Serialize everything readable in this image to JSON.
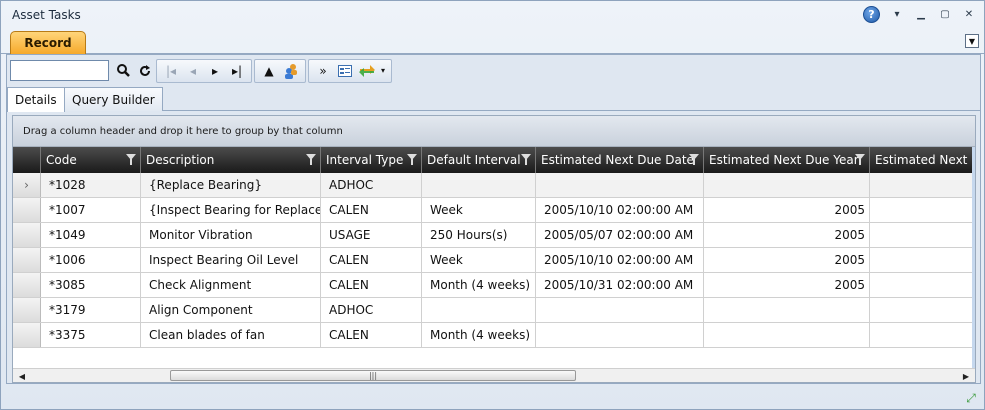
{
  "window": {
    "title": "Asset Tasks"
  },
  "tabs": {
    "record": "Record"
  },
  "subtabs": [
    {
      "label": "Details"
    },
    {
      "label": "Query Builder"
    }
  ],
  "search": {
    "value": "",
    "placeholder": ""
  },
  "grid": {
    "group_hint": "Drag a column header and drop it here to group by that column",
    "columns": [
      "Code",
      "Description",
      "Interval Type",
      "Default Interval",
      "Estimated Next Due Date",
      "Estimated Next Due Year",
      "Estimated Next D"
    ],
    "rows": [
      {
        "code": "*1028",
        "description": "{Replace Bearing}",
        "interval_type": "ADHOC",
        "default_interval": "",
        "due_date": "",
        "due_year": "",
        "next": ""
      },
      {
        "code": "*1007",
        "description": "{Inspect Bearing for Replacem",
        "interval_type": "CALEN",
        "default_interval": "Week",
        "due_date": "2005/10/10 02:00:00 AM",
        "due_year": "2005",
        "next": ""
      },
      {
        "code": "*1049",
        "description": "Monitor Vibration",
        "interval_type": "USAGE",
        "default_interval": "250 Hours(s)",
        "due_date": "2005/05/07 02:00:00 AM",
        "due_year": "2005",
        "next": ""
      },
      {
        "code": "*1006",
        "description": "Inspect Bearing Oil Level",
        "interval_type": "CALEN",
        "default_interval": "Week",
        "due_date": "2005/10/10 02:00:00 AM",
        "due_year": "2005",
        "next": ""
      },
      {
        "code": "*3085",
        "description": "Check Alignment",
        "interval_type": "CALEN",
        "default_interval": "Month (4 weeks)",
        "due_date": "2005/10/31 02:00:00 AM",
        "due_year": "2005",
        "next": ""
      },
      {
        "code": "*3179",
        "description": "Align Component",
        "interval_type": "ADHOC",
        "default_interval": "",
        "due_date": "",
        "due_year": "",
        "next": ""
      },
      {
        "code": "*3375",
        "description": "Clean blades of fan",
        "interval_type": "CALEN",
        "default_interval": "Month (4 weeks)",
        "due_date": "",
        "due_year": "",
        "next": ""
      }
    ]
  },
  "icons": {
    "help": "help-icon",
    "search": "search-icon",
    "refresh": "refresh-icon"
  },
  "colors": {
    "record_tab": "#f6a92b",
    "header_bg": "#1a1a1a",
    "accent": "#1f5aa8"
  }
}
